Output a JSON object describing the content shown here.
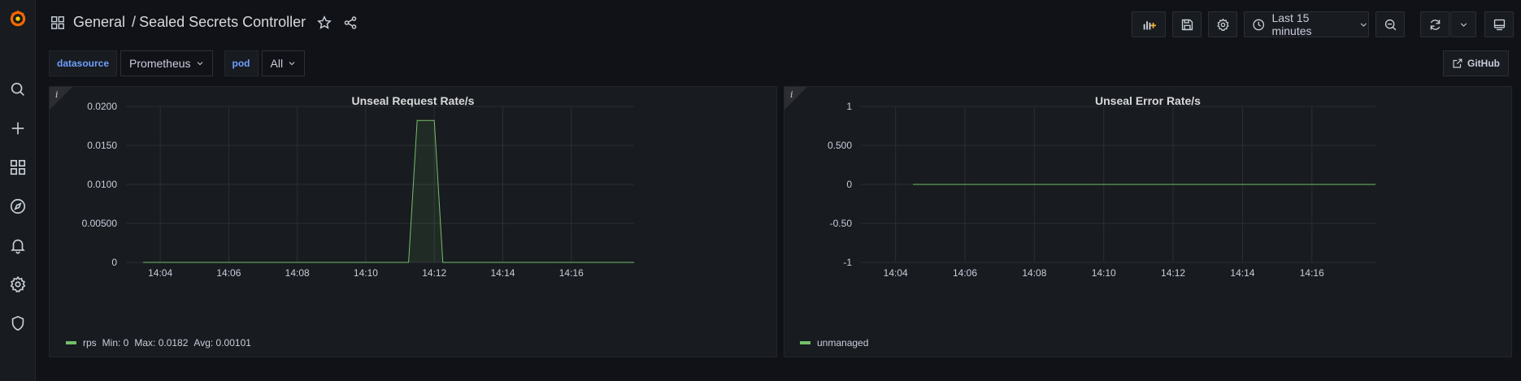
{
  "sidebar": {
    "items": [
      "grafana-logo",
      "search-icon",
      "plus-icon",
      "dashboards-icon",
      "explore-icon",
      "alerting-icon",
      "configuration-icon",
      "shield-icon"
    ]
  },
  "header": {
    "folder": "General",
    "separator": "/",
    "title": "Sealed Secrets Controller",
    "time_range_label": "Last 15 minutes"
  },
  "variables": [
    {
      "label": "datasource",
      "value": "Prometheus"
    },
    {
      "label": "pod",
      "value": "All"
    }
  ],
  "links": {
    "github": "GitHub"
  },
  "colors": {
    "series": "#73bf69",
    "accent": "#6e9fff"
  },
  "panels": [
    {
      "title": "Unseal Request Rate/s",
      "info": "i",
      "legend": {
        "name": "rps",
        "min": "Min: 0",
        "max": "Max: 0.0182",
        "avg": "Avg: 0.00101"
      }
    },
    {
      "title": "Unseal Error Rate/s",
      "info": "i",
      "legend": {
        "name": "unmanaged"
      }
    }
  ],
  "chart_data": [
    {
      "type": "area",
      "title": "Unseal Request Rate/s",
      "xlabel": "",
      "ylabel": "",
      "x_ticks": [
        "14:04",
        "14:06",
        "14:08",
        "14:10",
        "14:12",
        "14:14",
        "14:16"
      ],
      "y_ticks": [
        "0",
        "0.00500",
        "0.0100",
        "0.0150",
        "0.0200"
      ],
      "xlim": [
        "14:03:00",
        "14:17:50"
      ],
      "ylim": [
        0,
        0.02
      ],
      "grid": true,
      "legend_position": "bottom-left",
      "series": [
        {
          "name": "rps",
          "color": "#73bf69",
          "x": [
            "14:03:30",
            "14:11:15",
            "14:11:30",
            "14:12:00",
            "14:12:15",
            "14:17:50"
          ],
          "values": [
            0,
            0,
            0.0182,
            0.0182,
            0,
            0
          ]
        }
      ]
    },
    {
      "type": "line",
      "title": "Unseal Error Rate/s",
      "xlabel": "",
      "ylabel": "",
      "x_ticks": [
        "14:04",
        "14:06",
        "14:08",
        "14:10",
        "14:12",
        "14:14",
        "14:16"
      ],
      "y_ticks": [
        "1",
        "0.500",
        "0",
        "-0.50",
        "-1"
      ],
      "xlim": [
        "14:03:00",
        "14:17:50"
      ],
      "ylim": [
        -1,
        1
      ],
      "grid": true,
      "legend_position": "bottom-left",
      "series": [
        {
          "name": "unmanaged",
          "color": "#73bf69",
          "x": [
            "14:04:30",
            "14:17:50"
          ],
          "values": [
            0,
            0
          ]
        }
      ]
    }
  ]
}
